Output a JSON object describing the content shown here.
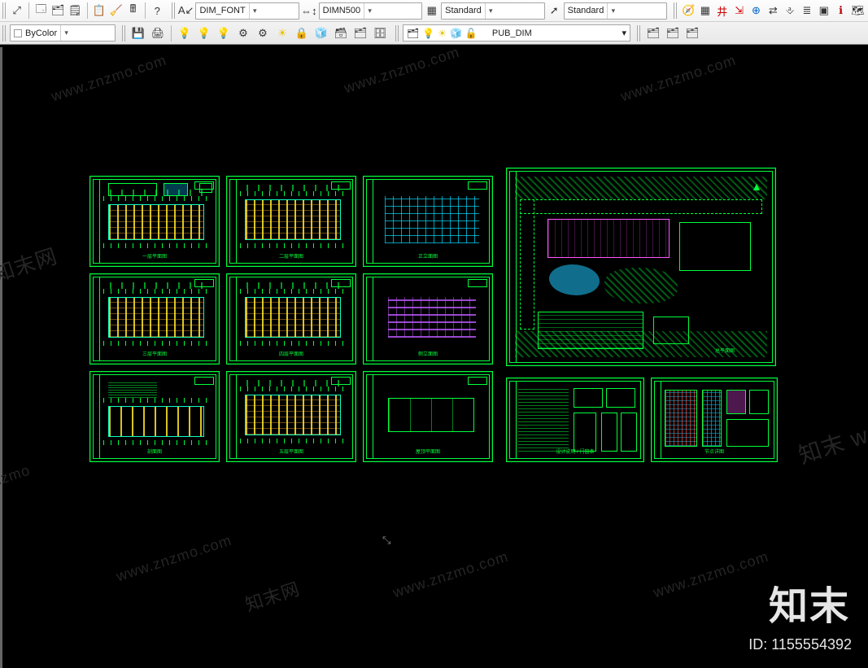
{
  "toolbar1": {
    "text_style_combo": "DIM_FONT",
    "dim_style_combo": "DIMN500",
    "table_style_combo": "Standard",
    "mleader_style_combo": "Standard"
  },
  "toolbar2": {
    "color_combo": "ByColor",
    "layer_current": "PUB_DIM"
  },
  "icons1": {
    "zoom": "⤢",
    "props": "🗔",
    "sheetset": "🗂",
    "palette": "🗒",
    "paste": "📋",
    "cleanscreen": "🧹",
    "calc": "🖩",
    "help": "?",
    "textstyle": "A↙",
    "dimstyle": "⇔↕",
    "tablestyle": "▦",
    "mleader": "➚",
    "seldisp": "🧭",
    "grid": "▦",
    "ortho": "井",
    "polar": "⇲",
    "osnap": "⊕",
    "otrack": "⇄",
    "dyn": "⎀",
    "lwt": "≣",
    "transp": "▣",
    "qp": "ℹ",
    "sc": "🗺"
  },
  "icons2": {
    "group1": [
      "💾",
      "🖨",
      "💡",
      "💡",
      "💡",
      "⚙",
      "⚙",
      "☀",
      "🔒",
      "🧊",
      "🗃",
      "🗂",
      "🗄"
    ],
    "layergroup": [
      "🗂",
      "💡",
      "☀",
      "🧊",
      "🔓",
      "▢"
    ],
    "tail": [
      "🗂",
      "🗂",
      "🗂"
    ]
  },
  "layer_color": "#ffffff",
  "watermarks": [
    "www.znzmo.com",
    "知末网",
    "www.znzmo.com",
    "www.znzmo.com",
    "znzmo",
    "www.znzmo.com",
    "知末网",
    "www.znzmo.com",
    "www.znzmo.com",
    "知末 w"
  ],
  "brand": {
    "logo_text": "知末",
    "id_label": "ID: 1155554392"
  },
  "sheets": {
    "row1": [
      {
        "label": "一层平面图",
        "type": "plan",
        "accent": "yellow"
      },
      {
        "label": "二层平面图",
        "type": "plan",
        "accent": "yellow"
      },
      {
        "label": "正立面图",
        "type": "elev",
        "accent": "cyan"
      }
    ],
    "row2": [
      {
        "label": "三层平面图",
        "type": "plan",
        "accent": "yellow"
      },
      {
        "label": "四层平面图",
        "type": "plan",
        "accent": "yellow"
      },
      {
        "label": "侧立面图",
        "type": "elev",
        "accent": "purple"
      }
    ],
    "row3": [
      {
        "label": "剖面图",
        "type": "plan",
        "accent": "yellow"
      },
      {
        "label": "五层平面图",
        "type": "plan",
        "accent": "yellow"
      },
      {
        "label": "屋顶平面图",
        "type": "roof",
        "accent": "green"
      }
    ],
    "site": {
      "label": "总平面图"
    },
    "details": [
      {
        "label": "设计说明 / 门窗表"
      },
      {
        "label": "节点详图"
      }
    ]
  }
}
